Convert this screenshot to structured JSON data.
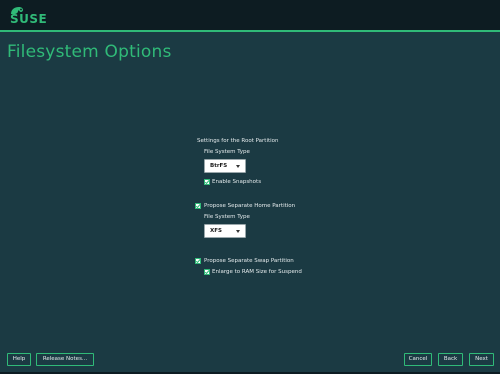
{
  "header": {
    "brand": "SUSE",
    "accent": "#30ba78"
  },
  "page_title": "Filesystem Options",
  "root_partition": {
    "heading": "Settings for the Root Partition",
    "fs_type_label": "File System Type",
    "fs_type_value": "BtrFS",
    "snapshots_label": "Enable Snapshots",
    "snapshots_checked": true
  },
  "home_partition": {
    "propose_label": "Propose Separate Home Partition",
    "propose_checked": true,
    "fs_type_label": "File System Type",
    "fs_type_value": "XFS"
  },
  "swap_partition": {
    "propose_label": "Propose Separate Swap Partition",
    "propose_checked": true,
    "enlarge_label": "Enlarge to RAM Size for Suspend",
    "enlarge_checked": true
  },
  "buttons": {
    "help": "Help",
    "release_notes": "Release Notes...",
    "cancel": "Cancel",
    "back": "Back",
    "next": "Next"
  }
}
